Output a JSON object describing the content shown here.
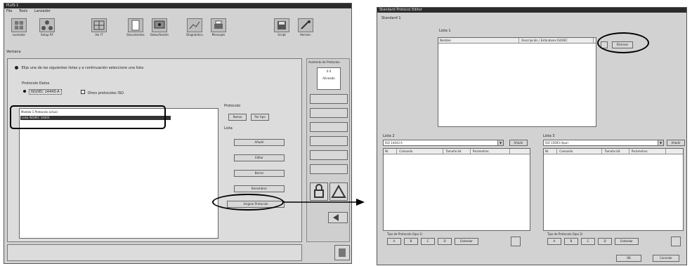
{
  "left_window": {
    "title": "PLUS-1",
    "menu": [
      "File",
      "Tools",
      "Lanzador"
    ],
    "toolbar": [
      {
        "label": "Lanzador",
        "icon": "grid-icon"
      },
      {
        "label": "Setup RF",
        "icon": "tree-icon"
      },
      {
        "label": "Ver IT",
        "icon": "network-icon"
      },
      {
        "label": "Documentos",
        "icon": "document-icon"
      },
      {
        "label": "Datos/Sesión",
        "icon": "monitor-icon"
      },
      {
        "label": "Diagnóstico",
        "icon": "chart-icon"
      },
      {
        "label": "Mensajes",
        "icon": "printer-icon"
      },
      {
        "label": "Script",
        "icon": "disk-icon"
      },
      {
        "label": "Herram.",
        "icon": "tool-icon"
      }
    ],
    "section_label": "Ventana",
    "radio_text": "Elija una de las siguientes listas y a continuación seleccione una lista",
    "group_label": "Protocolo Datos",
    "option_a": "ISO/IEC 14443-A",
    "option_b": "Otros protocolos ISO",
    "list_header": "Modelo    1 Protocolo actual",
    "list_selected": "Lista    ISO/IEC 14443",
    "protocol_label": "Protocolo",
    "protocol_options": [
      "Nuevo",
      "Por tipo"
    ],
    "lists_label": "Lista",
    "buttons": [
      "Añadir",
      "Editar",
      "Borrar",
      "Renombrar"
    ],
    "highlight_button": "Asignar Protocolo",
    "right_panel_title": "Asistente de Protocolo",
    "right_panel_value": "0 0",
    "right_panel_sub": "Alineado"
  },
  "right_window": {
    "title": "Standard Protocol Editor",
    "group_label": "Standard 1",
    "top_list_label": "Lista 1",
    "top_list_headers": [
      "Nombre",
      "Descripción / Estándares ISO/IEC"
    ],
    "delete_button": "Eliminar",
    "left_box_label": "Lista 2",
    "left_dropdown": "ISO 14443 A",
    "left_add": "Añadir",
    "left_headers": [
      "Nr.",
      "Comando",
      "Tamaño bit",
      "Parámetros"
    ],
    "right_box_label": "Lista 3",
    "right_dropdown": "ISO 15693 (tipo)",
    "right_add": "Añadir",
    "right_headers": [
      "Nr.",
      "Comando",
      "Tamaño bit",
      "Parámetros"
    ],
    "left_footer_label": "Tipo de Protocolo (tipo 1)",
    "left_footer_items": [
      "A",
      "B",
      "C",
      "D",
      "Estándar"
    ],
    "right_footer_label": "Tipo de Protocolo (tipo 2)",
    "right_footer_items": [
      "A",
      "B",
      "C",
      "D",
      "Estándar"
    ],
    "ok": "OK",
    "cancel": "Cancelar"
  }
}
